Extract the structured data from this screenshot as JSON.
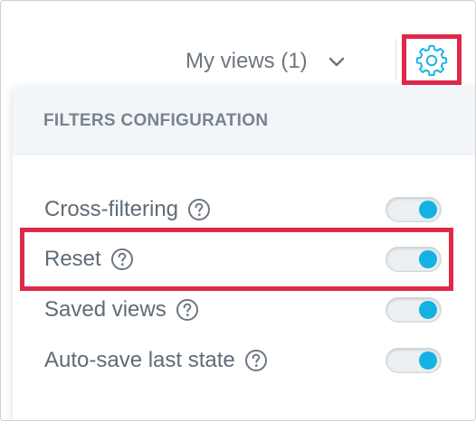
{
  "header": {
    "views_label": "My views (1)",
    "gear_icon": "gear-icon",
    "chevron_icon": "chevron-down-icon"
  },
  "panel": {
    "title": "FILTERS CONFIGURATION",
    "items": [
      {
        "label": "Cross-filtering",
        "enabled": true
      },
      {
        "label": "Reset",
        "enabled": true
      },
      {
        "label": "Saved views",
        "enabled": true
      },
      {
        "label": "Auto-save last state",
        "enabled": true
      }
    ]
  },
  "colors": {
    "accent": "#14b2e2",
    "highlight": "#e02848",
    "text": "#5f6b76"
  }
}
